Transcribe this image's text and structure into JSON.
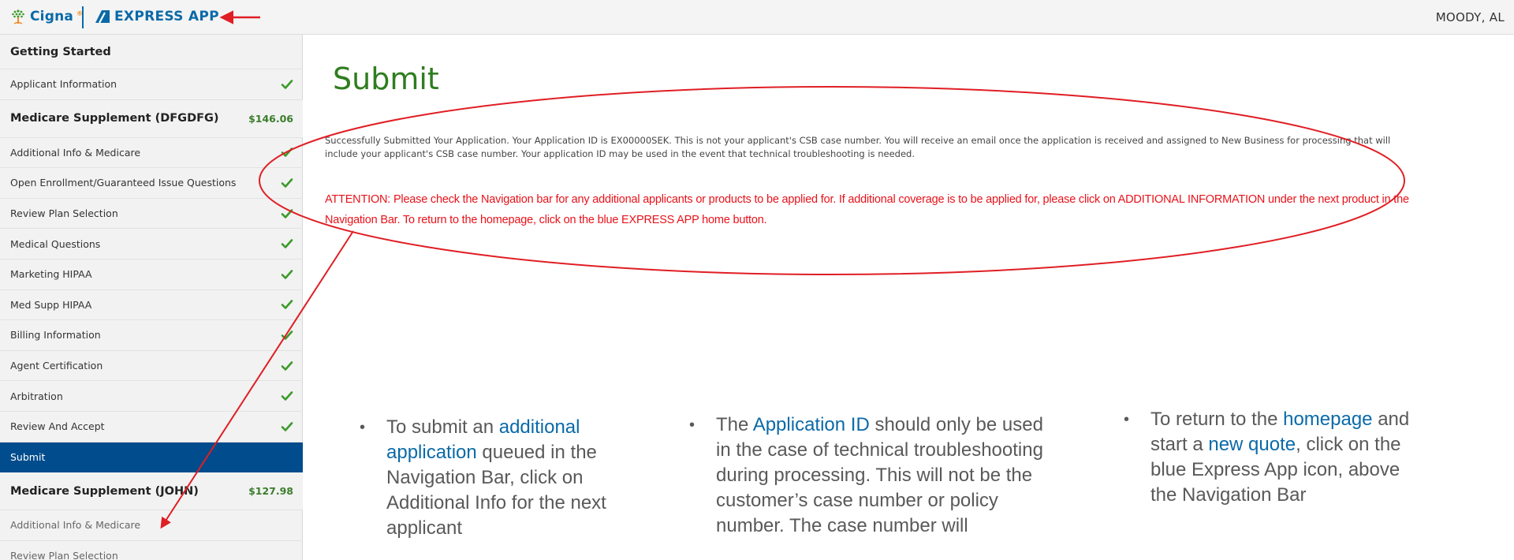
{
  "header": {
    "cigna_logo_text": "Cigna",
    "express_app_label": "EXPRESS APP",
    "user_name": "MOODY, AL"
  },
  "sidebar": {
    "items": [
      {
        "label": "Getting Started",
        "kind": "section"
      },
      {
        "label": "Applicant Information",
        "kind": "item",
        "complete": true
      },
      {
        "label": "Medicare Supplement (DFGDFG)",
        "kind": "group",
        "price": "$146.06"
      },
      {
        "label": "Additional Info & Medicare",
        "kind": "item",
        "complete": true
      },
      {
        "label": "Open Enrollment/Guaranteed Issue Questions",
        "kind": "item",
        "complete": true
      },
      {
        "label": "Review Plan Selection",
        "kind": "item",
        "complete": true
      },
      {
        "label": "Medical Questions",
        "kind": "item",
        "complete": true
      },
      {
        "label": "Marketing HIPAA",
        "kind": "item",
        "complete": true
      },
      {
        "label": "Med Supp HIPAA",
        "kind": "item",
        "complete": true
      },
      {
        "label": "Billing Information",
        "kind": "item",
        "complete": true
      },
      {
        "label": "Agent Certification",
        "kind": "item",
        "complete": true
      },
      {
        "label": "Arbitration",
        "kind": "item",
        "complete": true
      },
      {
        "label": "Review And Accept",
        "kind": "item",
        "complete": true
      },
      {
        "label": "Submit",
        "kind": "item",
        "active": true
      },
      {
        "label": "Medicare Supplement (JOHN)",
        "kind": "group",
        "price": "$127.98"
      },
      {
        "label": "Additional Info & Medicare",
        "kind": "item"
      },
      {
        "label": "Review Plan Selection",
        "kind": "item"
      }
    ]
  },
  "main": {
    "title": "Submit",
    "success_message": "Successfully Submitted Your Application. Your Application ID is EX00000SEK. This is not your applicant's CSB case number. You will receive an email once the application is received and assigned to New Business for processing that will include your applicant's CSB case number. Your application ID may be used in the event that technical troubleshooting is needed.",
    "attention_message": "ATTENTION: Please check the Navigation bar for any additional applicants or products to be applied for. If additional coverage is to be applied for, please click on ADDITIONAL INFORMATION under the next product in the Navigation Bar. To return to the homepage, click on the blue EXPRESS APP home button."
  },
  "annotations": {
    "note_1": {
      "pre": "To submit an ",
      "highlight": "additional application",
      "post": " queued in the Navigation Bar, click on Additional Info for the next applicant"
    },
    "note_2": {
      "pre": "The ",
      "highlight": "Application ID",
      "post": " should only be used in the case of technical troubleshooting during processing. This will not be the customer’s case number or policy number. The case number will"
    },
    "note_3": {
      "pre": "To return to the ",
      "highlight_1": "homepage",
      "mid": " and start a ",
      "highlight_2": "new quote",
      "post": ", click on the blue Express App icon, above the Navigation Bar"
    }
  },
  "colors": {
    "brand_blue": "#0a6aa8",
    "nav_active": "#004c8c",
    "title_green": "#2f7d1f",
    "check_green": "#3a9a28",
    "attention_red": "#e8121a",
    "annotation_red": "#e01e24"
  },
  "icons": {
    "logo": "cigna-tree-icon",
    "express_app": "express-app-icon",
    "completed": "checkmark-icon",
    "pointer": "red-arrow-icon"
  }
}
